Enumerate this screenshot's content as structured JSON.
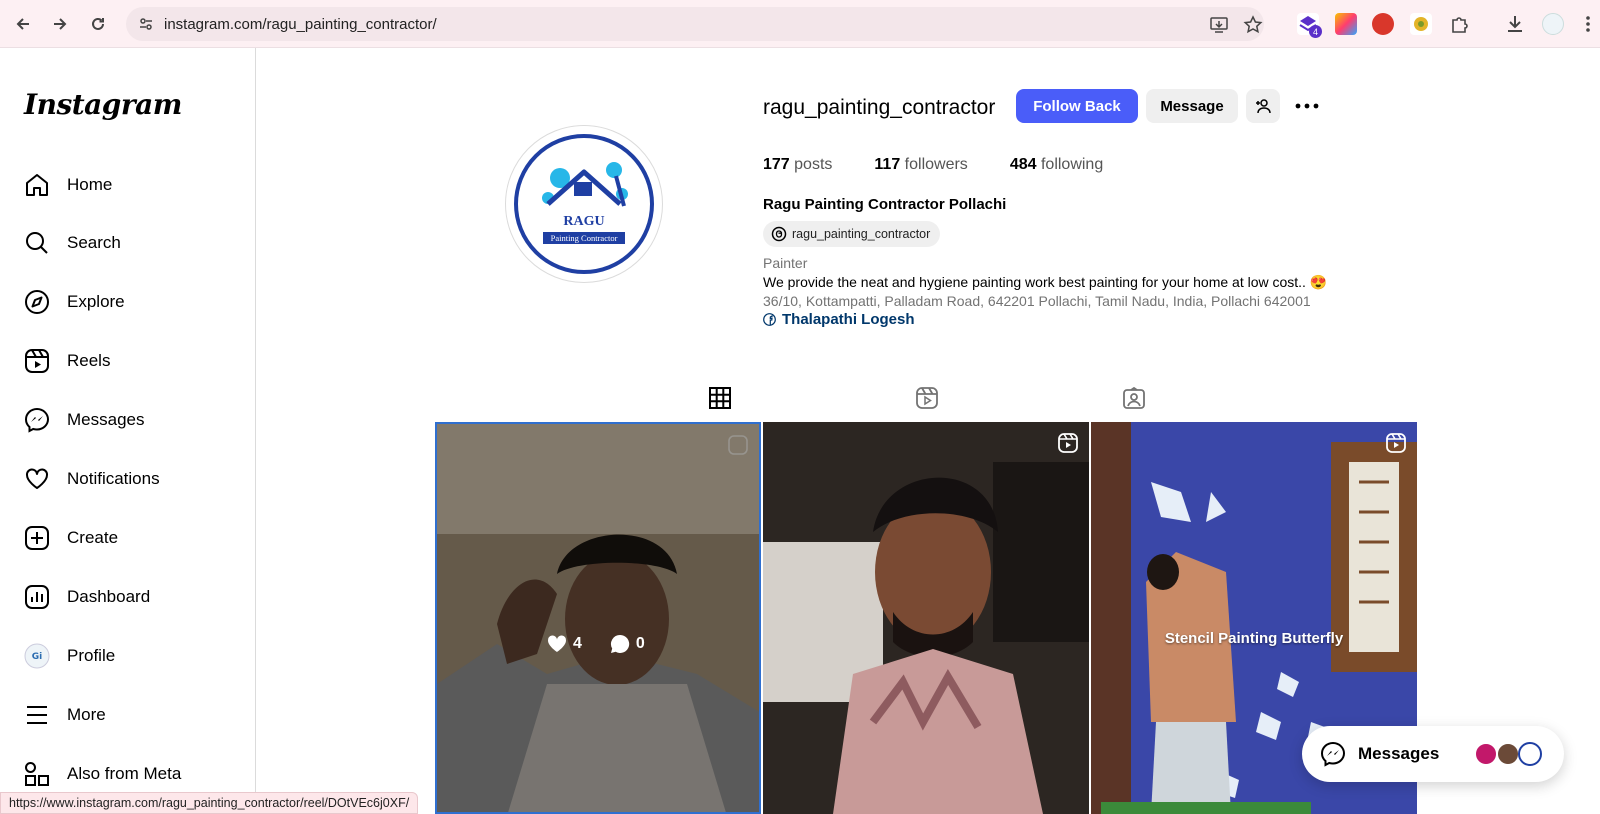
{
  "browser": {
    "url": "instagram.com/ragu_painting_contractor/",
    "extension_badge": "4",
    "status_url": "https://www.instagram.com/ragu_painting_contractor/reel/DOtVEc6j0XF/"
  },
  "sidebar": {
    "logo": "Instagram",
    "items": [
      {
        "label": "Home",
        "icon": "home-icon"
      },
      {
        "label": "Search",
        "icon": "search-icon"
      },
      {
        "label": "Explore",
        "icon": "compass-icon"
      },
      {
        "label": "Reels",
        "icon": "reels-icon"
      },
      {
        "label": "Messages",
        "icon": "messenger-icon"
      },
      {
        "label": "Notifications",
        "icon": "heart-icon"
      },
      {
        "label": "Create",
        "icon": "plus-square-icon"
      },
      {
        "label": "Dashboard",
        "icon": "bar-chart-icon"
      },
      {
        "label": "Profile",
        "icon": "profile-avatar-icon"
      },
      {
        "label": "More",
        "icon": "hamburger-icon"
      },
      {
        "label": "Also from Meta",
        "icon": "meta-apps-icon"
      }
    ]
  },
  "profile": {
    "username": "ragu_painting_contractor",
    "follow_label": "Follow Back",
    "message_label": "Message",
    "posts_count": "177",
    "posts_label": "posts",
    "followers_count": "117",
    "followers_label": "followers",
    "following_count": "484",
    "following_label": "following",
    "full_name": "Ragu Painting Contractor Pollachi",
    "threads_handle": "ragu_painting_contractor",
    "category": "Painter",
    "bio": "We provide the neat and hygiene painting work best painting for your home at low cost.. 😍",
    "address": "36/10, Kottampatti, Palladam Road, 642201 Pollachi, Tamil Nadu, India, Pollachi 642001",
    "link_label": "Thalapathi Logesh",
    "avatar_text": "RAGU",
    "avatar_subtext": "Painting Contractor"
  },
  "tabs": [
    {
      "name": "posts",
      "icon": "grid-icon",
      "active": true
    },
    {
      "name": "reels",
      "icon": "reels-icon",
      "active": false
    },
    {
      "name": "tagged",
      "icon": "tagged-icon",
      "active": false
    }
  ],
  "posts": [
    {
      "type": "reel",
      "likes": "4",
      "comments": "0",
      "hovered": true
    },
    {
      "type": "reel"
    },
    {
      "type": "reel",
      "caption": "Stencil Painting Butterfly"
    }
  ],
  "messages_widget": {
    "label": "Messages"
  },
  "colors": {
    "accent": "#4a5df9",
    "link": "#00376b",
    "avatar_ring": "#1f3fa3"
  }
}
